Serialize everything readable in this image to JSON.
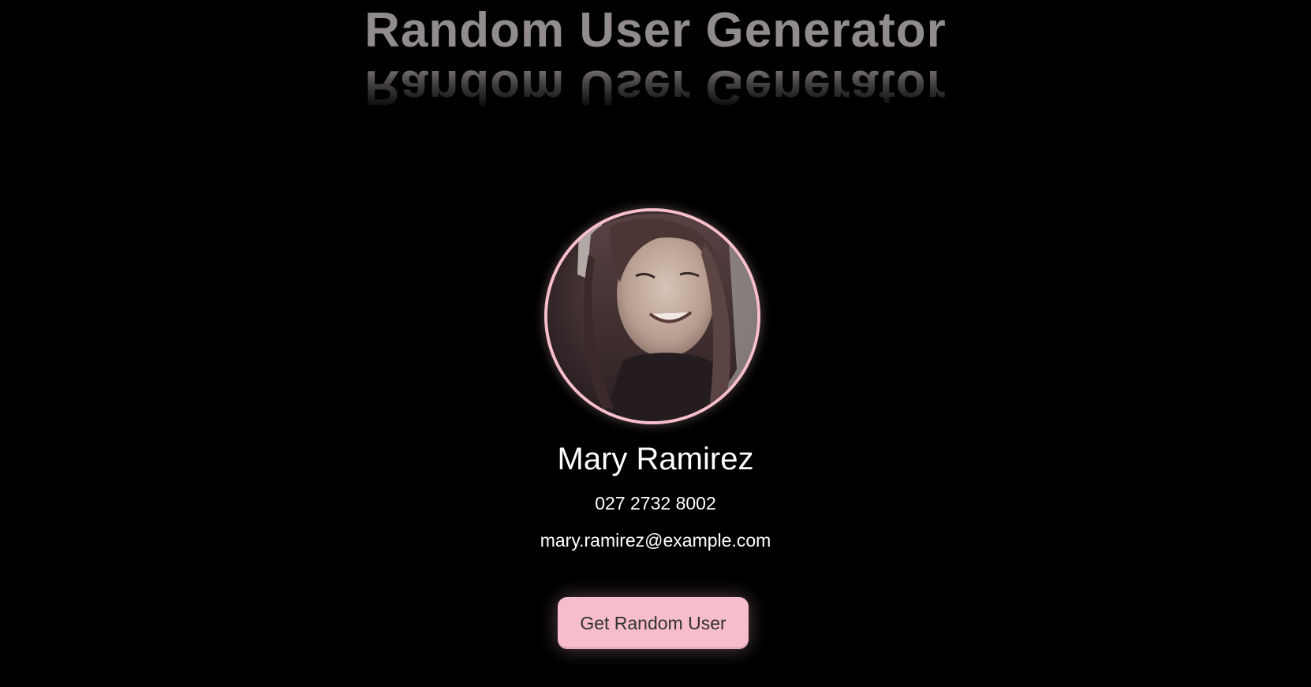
{
  "header": {
    "title": "Random User Generator",
    "title_color": "#918b8b"
  },
  "user": {
    "avatar_label": "user-portrait",
    "name": "Mary Ramirez",
    "phone": "027 2732 8002",
    "email": "mary.ramirez@example.com"
  },
  "actions": {
    "get_user_label": "Get Random User"
  },
  "theme": {
    "background": "#000000",
    "accent_pink": "#f7bdca",
    "text": "#ffffff"
  }
}
